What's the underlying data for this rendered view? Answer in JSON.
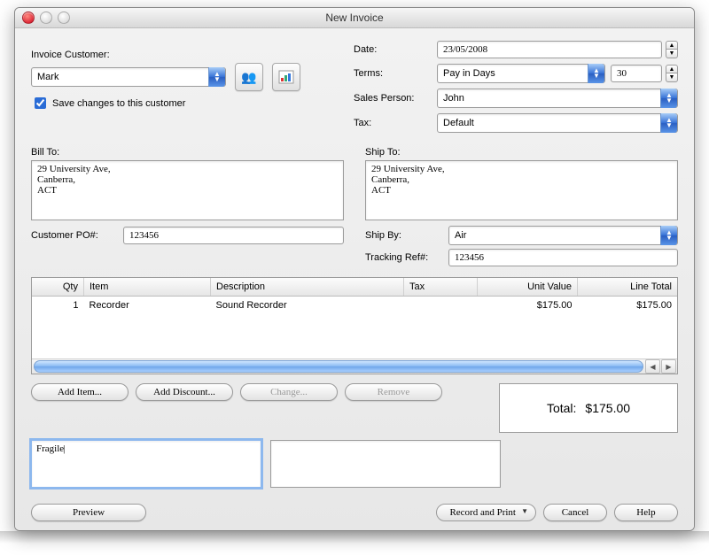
{
  "window": {
    "title": "New Invoice"
  },
  "customer": {
    "label": "Invoice Customer:",
    "value": "Mark",
    "save_checkbox_label": "Save changes to this customer",
    "save_checked": true
  },
  "header": {
    "date_label": "Date:",
    "date_value": "23/05/2008",
    "terms_label": "Terms:",
    "terms_value": "Pay in Days",
    "terms_days": "30",
    "salesperson_label": "Sales Person:",
    "salesperson_value": "John",
    "tax_label": "Tax:",
    "tax_value": "Default"
  },
  "billto": {
    "label": "Bill To:",
    "text": "29 University Ave,\nCanberra,\nACT"
  },
  "shipto": {
    "label": "Ship To:",
    "text": "29 University Ave,\nCanberra,\nACT"
  },
  "po": {
    "label": "Customer PO#:",
    "value": "123456"
  },
  "shipby": {
    "label": "Ship By:",
    "value": "Air"
  },
  "tracking": {
    "label": "Tracking Ref#:",
    "value": "123456"
  },
  "table": {
    "columns": [
      "Qty",
      "Item",
      "Description",
      "Tax",
      "Unit Value",
      "Line Total"
    ],
    "rows": [
      {
        "qty": "1",
        "item": "Recorder",
        "desc": "Sound Recorder",
        "tax": "",
        "unit": "$175.00",
        "line": "$175.00"
      }
    ]
  },
  "buttons": {
    "add_item": "Add Item...",
    "add_discount": "Add Discount...",
    "change": "Change...",
    "remove": "Remove",
    "preview": "Preview",
    "record_print": "Record and Print",
    "cancel": "Cancel",
    "help": "Help"
  },
  "notes": {
    "comment": "Fragile",
    "private": ""
  },
  "totals": {
    "label": "Total:",
    "value": "$175.00"
  }
}
